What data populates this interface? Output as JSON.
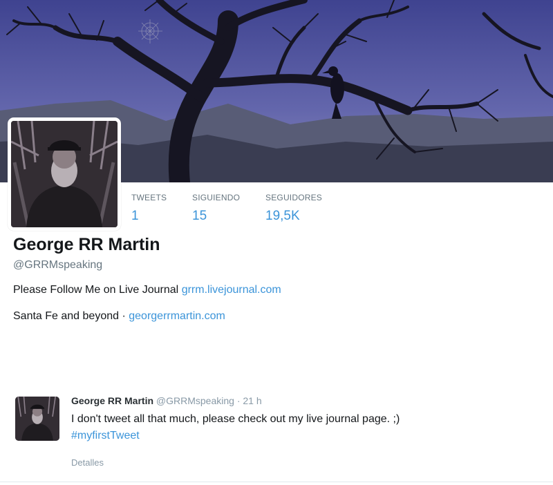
{
  "profile": {
    "name": "George RR Martin",
    "handle": "@GRRMspeaking",
    "bio_text": "Please Follow Me on Live Journal",
    "bio_link": "grrm.livejournal.com",
    "location": "Santa Fe and beyond",
    "separator": "·",
    "website": "georgerrmartin.com"
  },
  "stats": {
    "tweets_label": "TWEETS",
    "tweets_value": "1",
    "following_label": "SIGUIENDO",
    "following_value": "15",
    "followers_label": "SEGUIDORES",
    "followers_value": "19,5K"
  },
  "tweet": {
    "author_name": "George RR Martin",
    "author_handle": "@GRRMspeaking",
    "time": "· 21 h",
    "text": "I don't tweet all that much, please check out my live journal page. ;)",
    "hashtag": "#myfirstTweet",
    "details_label": "Detalles"
  },
  "colors": {
    "link": "#3b94d9",
    "banner_sky": "#5b5fa8",
    "muted": "#66757f"
  }
}
